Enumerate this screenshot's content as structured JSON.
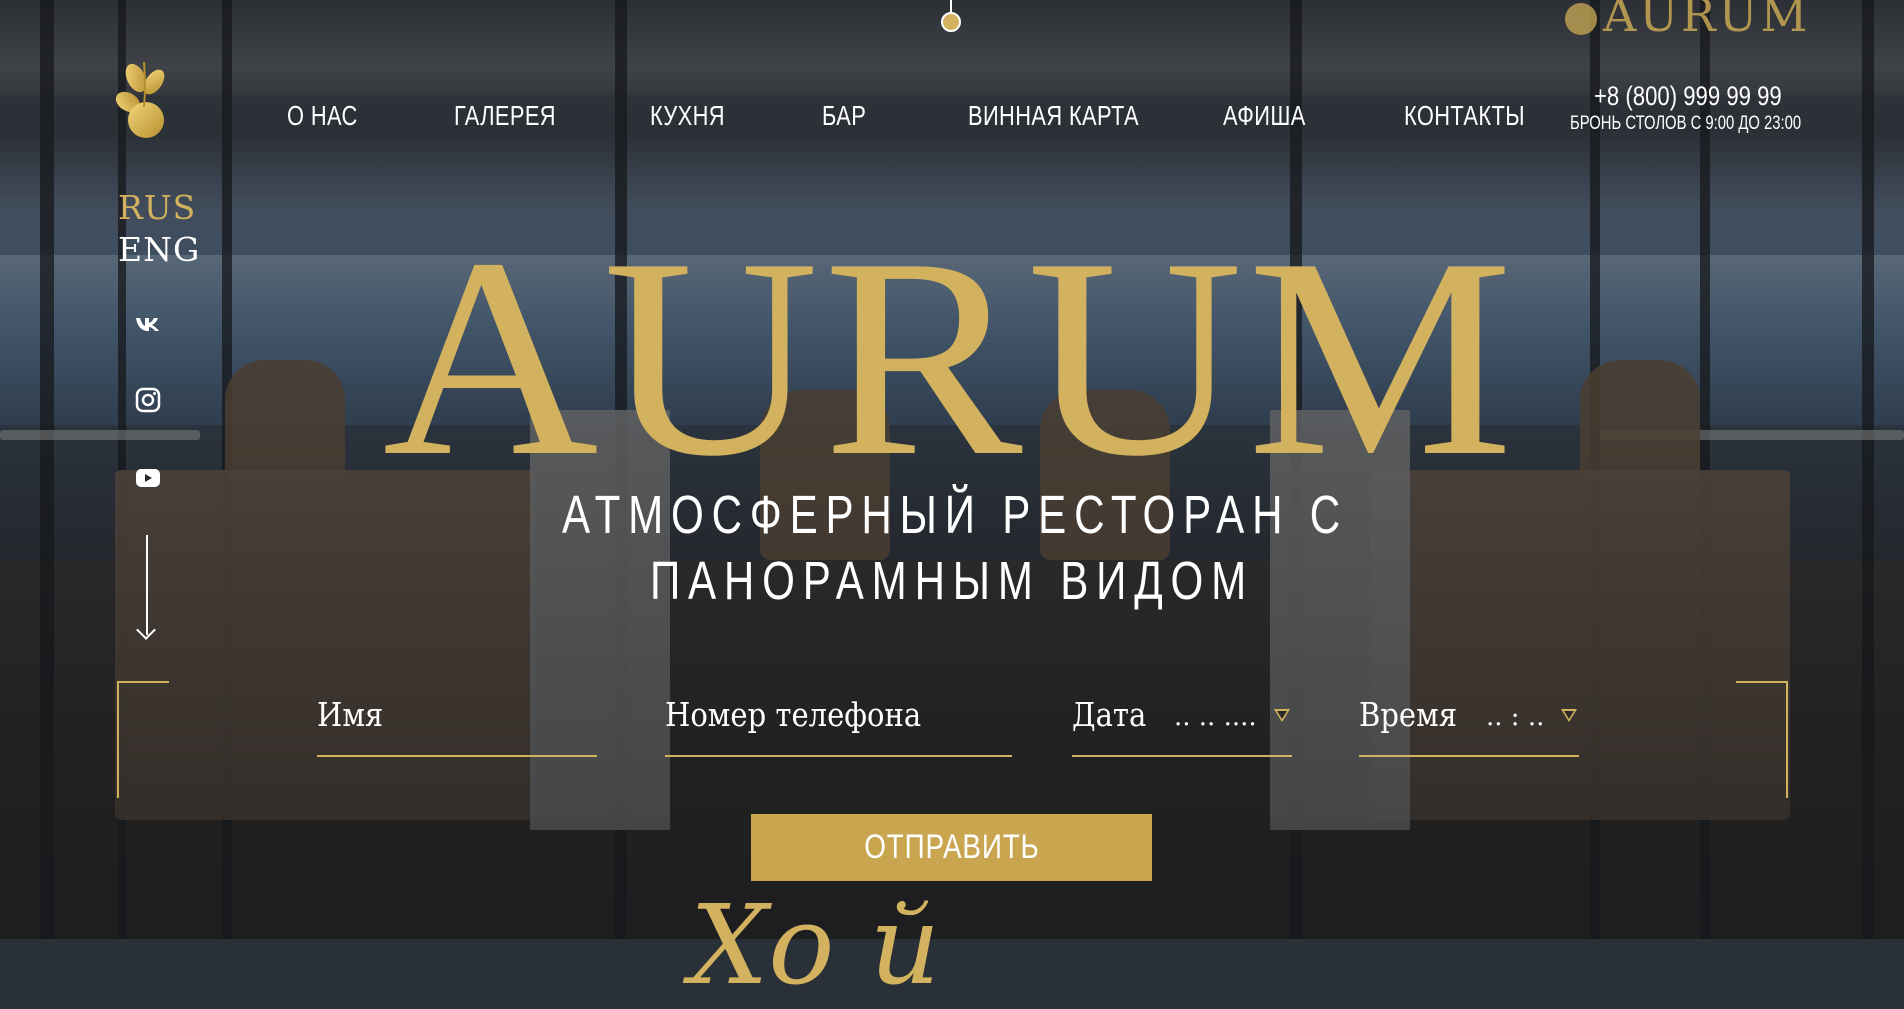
{
  "brand": {
    "corner_logo": "AURUM",
    "hero_title": "AURUM",
    "hero_subtitle_line1": "АТМОСФЕРНЫЙ РЕСТОРАН С",
    "hero_subtitle_line2": "ПАНОРАМНЫМ ВИДОМ",
    "accent_color": "#d3b25f"
  },
  "languages": [
    {
      "label": "RUS",
      "active": true
    },
    {
      "label": "ENG",
      "active": false
    }
  ],
  "social": [
    {
      "icon": "vk-icon"
    },
    {
      "icon": "instagram-icon"
    },
    {
      "icon": "youtube-icon"
    }
  ],
  "nav": {
    "items": [
      {
        "label": "О НАС"
      },
      {
        "label": "ГАЛЕРЕЯ"
      },
      {
        "label": "КУХНЯ"
      },
      {
        "label": "БАР"
      },
      {
        "label": "ВИННАЯ КАРТА"
      },
      {
        "label": "АФИША"
      },
      {
        "label": "КОНТАКТЫ"
      }
    ]
  },
  "contact": {
    "phone": "+8 (800) 999 99 99",
    "hours": "БРОНЬ СТОЛОВ С 9:00 ДО 23:00"
  },
  "booking_form": {
    "name_placeholder": "Имя",
    "phone_placeholder": "Номер телефона",
    "date_label": "Дата",
    "date_value": ".. .. ....",
    "time_label": "Время",
    "time_value": ".. : ..",
    "submit_label": "ОТПРАВИТЬ"
  },
  "footer_script": "Хо        й"
}
